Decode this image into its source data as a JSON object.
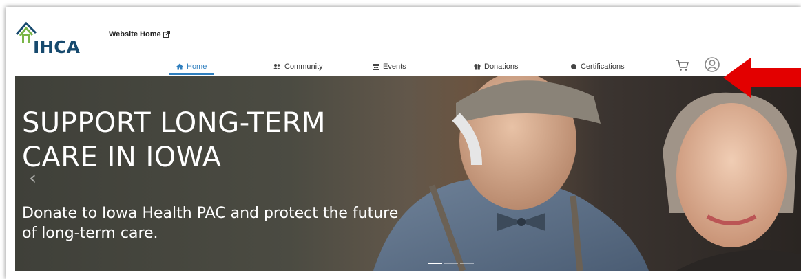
{
  "header": {
    "logo_text": "IHCA",
    "website_home": "Website Home"
  },
  "nav": {
    "items": [
      {
        "label": "Home",
        "icon": "home-icon"
      },
      {
        "label": "Community",
        "icon": "users-icon"
      },
      {
        "label": "Events",
        "icon": "calendar-icon"
      },
      {
        "label": "Donations",
        "icon": "gift-icon"
      },
      {
        "label": "Certifications",
        "icon": "certificate-icon"
      }
    ],
    "active": "Home"
  },
  "hero": {
    "headline": "SUPPORT LONG-TERM CARE IN IOWA",
    "subtext": "Donate to Iowa Health PAC and protect the future of long-term care.",
    "prev_glyph": "‹",
    "slide_count": 3,
    "active_slide": 1
  },
  "colors": {
    "accent": "#2f7fbf",
    "logo": "#174a6e",
    "logo_green": "#7ab648",
    "annotation_arrow": "#e30000"
  }
}
